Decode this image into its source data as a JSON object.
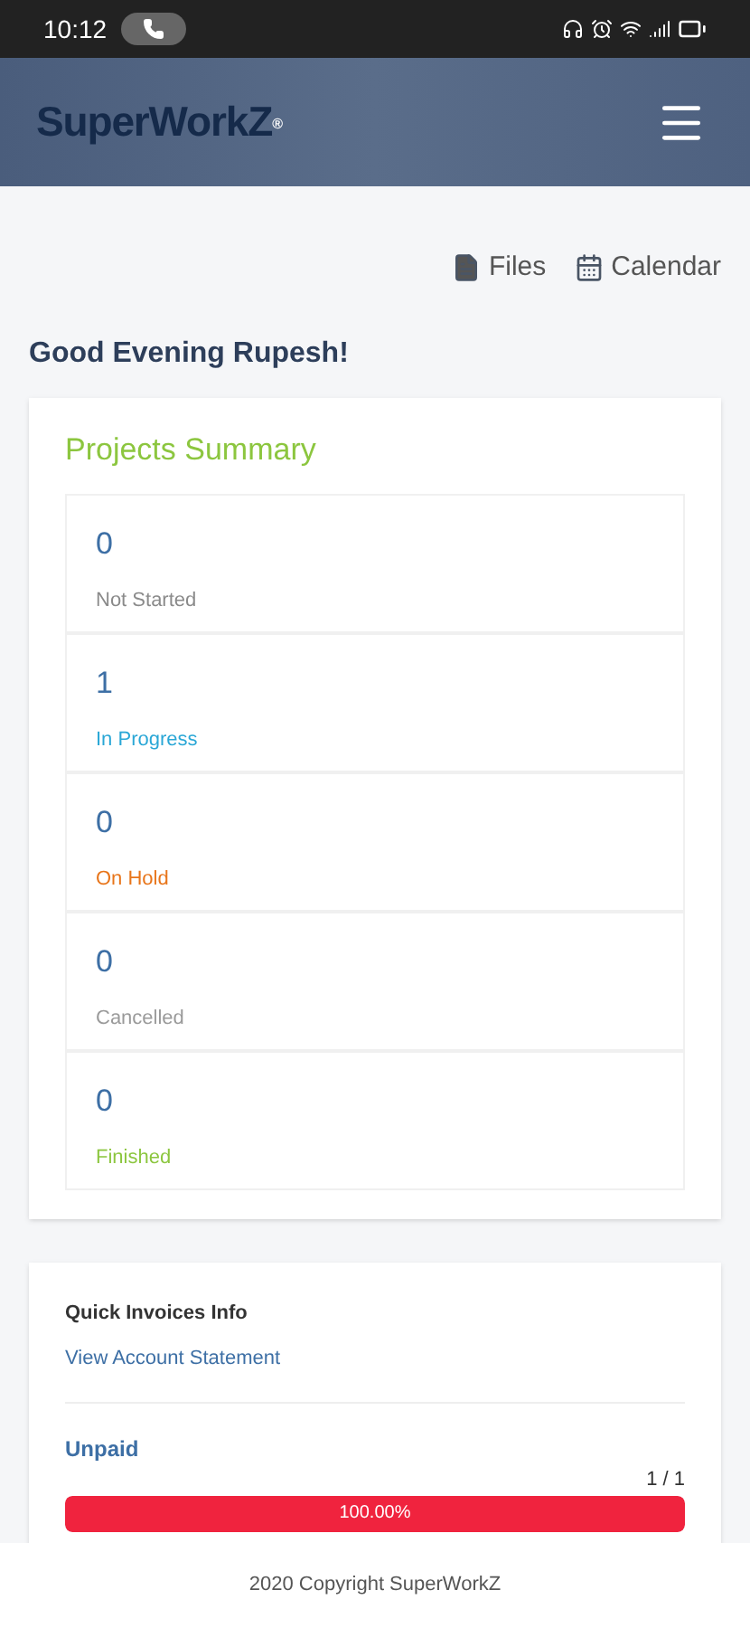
{
  "status_bar": {
    "time": "10:12"
  },
  "header": {
    "logo": "SuperWorkZ",
    "logo_mark": "®"
  },
  "quick_links": [
    {
      "kind": "file",
      "label": "Files"
    },
    {
      "kind": "calendar",
      "label": "Calendar"
    }
  ],
  "greeting": "Good Evening Rupesh!",
  "projects_summary": {
    "title": "Projects Summary",
    "items": [
      {
        "count": "0",
        "label": "Not Started",
        "color": "#8a8a8a"
      },
      {
        "count": "1",
        "label": "In Progress",
        "color": "#2aa7d6"
      },
      {
        "count": "0",
        "label": "On Hold",
        "color": "#e8751a"
      },
      {
        "count": "0",
        "label": "Cancelled",
        "color": "#9a9a9a"
      },
      {
        "count": "0",
        "label": "Finished",
        "color": "#8cc63f"
      }
    ]
  },
  "invoices": {
    "title": "Quick Invoices Info",
    "link": "View Account Statement",
    "sections": [
      {
        "label": "Unpaid",
        "ratio": "1 / 1",
        "level": 1,
        "reading": "100.00%"
      }
    ]
  },
  "footer": "2020 Copyright SuperWorkZ"
}
